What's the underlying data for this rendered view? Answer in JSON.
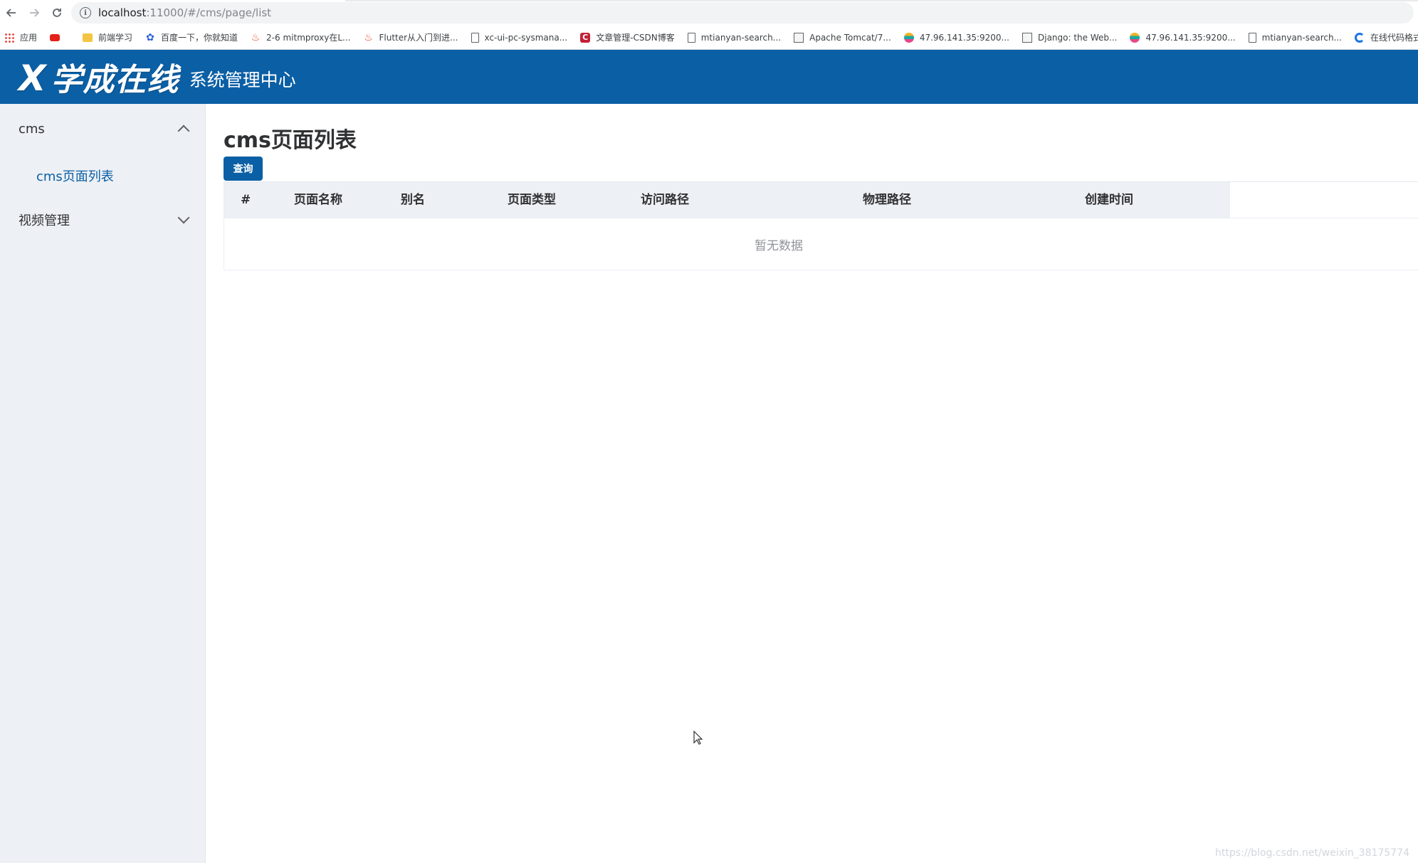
{
  "browser": {
    "url_host": "localhost",
    "url_path": ":11000/#/cms/page/list",
    "bookmarks": [
      {
        "label": "应用",
        "icon": "apps-grid-icon"
      },
      {
        "label": "",
        "icon": "youtube-icon"
      },
      {
        "label": "前端学习",
        "icon": "folder-icon"
      },
      {
        "label": "百度一下，你就知道",
        "icon": "baidu-paw-icon"
      },
      {
        "label": "2-6 mitmproxy在L...",
        "icon": "fire-icon"
      },
      {
        "label": "Flutter从入门到进...",
        "icon": "fire-icon"
      },
      {
        "label": "xc-ui-pc-sysmana...",
        "icon": "page-icon"
      },
      {
        "label": "文章管理-CSDN博客",
        "icon": "csdn-icon"
      },
      {
        "label": "mtianyan-search...",
        "icon": "page-icon"
      },
      {
        "label": "Apache Tomcat/7...",
        "icon": "tomcat-icon"
      },
      {
        "label": "47.96.141.35:9200...",
        "icon": "elastic-icon"
      },
      {
        "label": "Django: the Web...",
        "icon": "django-icon"
      },
      {
        "label": "47.96.141.35:9200...",
        "icon": "elastic-icon"
      },
      {
        "label": "mtianyan-search...",
        "icon": "page-icon"
      },
      {
        "label": "在线代码格式化",
        "icon": "google-c-icon"
      }
    ]
  },
  "header": {
    "logo_mark": "X",
    "logo_text": "学成在线",
    "subtitle": "系统管理中心",
    "bg_color": "#0b5fa5"
  },
  "sidebar": {
    "menus": [
      {
        "label": "cms",
        "expanded": true,
        "items": [
          {
            "label": "cms页面列表",
            "active": true
          }
        ]
      },
      {
        "label": "视频管理",
        "expanded": false,
        "items": []
      }
    ]
  },
  "main": {
    "title": "cms页面列表",
    "query_button": "查询",
    "table": {
      "columns": [
        "#",
        "页面名称",
        "别名",
        "页面类型",
        "访问路径",
        "物理路径",
        "创建时间"
      ],
      "rows": [],
      "empty_text": "暂无数据"
    }
  },
  "watermark": "https://blog.csdn.net/weixin_38175774"
}
